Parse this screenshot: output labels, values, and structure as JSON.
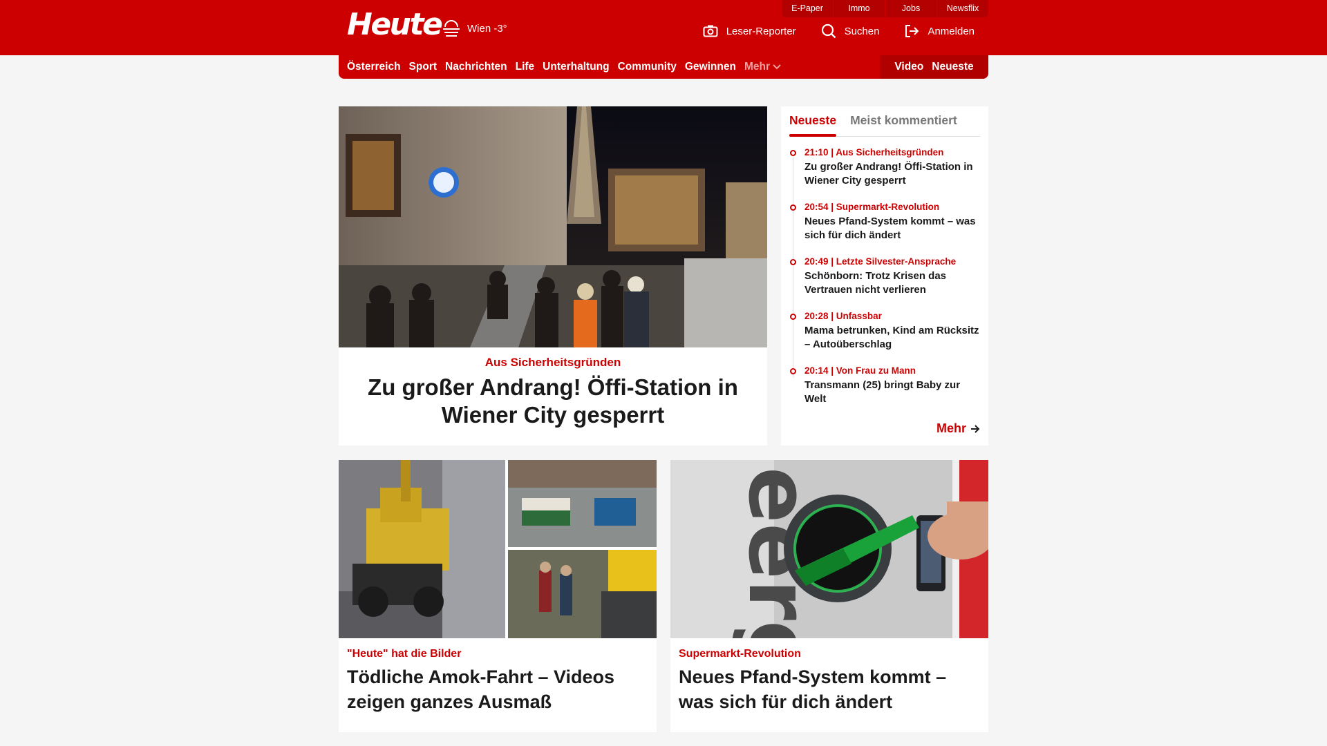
{
  "header": {
    "logo": "Heute",
    "weather": "Wien -3°",
    "service_links": [
      "E-Paper",
      "Immo",
      "Jobs",
      "Newsflix"
    ],
    "actions": {
      "reporter": "Leser-Reporter",
      "search": "Suchen",
      "login": "Anmelden"
    }
  },
  "nav": {
    "items": [
      "Österreich",
      "Sport",
      "Nachrichten",
      "Life",
      "Unterhaltung",
      "Community",
      "Gewinnen"
    ],
    "more": "Mehr",
    "video": "Video",
    "latest": "Neueste"
  },
  "hero": {
    "kicker": "Aus Sicherheitsgründen",
    "headline": "Zu großer Andrang! Öffi-Station in Wiener City gesperrt"
  },
  "sidebar": {
    "tabs": [
      "Neueste",
      "Meist kommentiert"
    ],
    "items": [
      {
        "meta": "21:10 | Aus Sicherheitsgründen",
        "title": "Zu großer Andrang! Öffi-Station in Wiener City gesperrt"
      },
      {
        "meta": "20:54 | Supermarkt-Revolution",
        "title": "Neues Pfand-System kommt – was sich für dich ändert"
      },
      {
        "meta": "20:49 | Letzte Silvester-Ansprache",
        "title": "Schönborn: Trotz Krisen das Vertrauen nicht verlieren"
      },
      {
        "meta": "20:28 | Unfassbar",
        "title": "Mama betrunken, Kind am Rücksitz – Autoüberschlag"
      },
      {
        "meta": "20:14 | Von Frau zu Mann",
        "title": "Transmann (25) bringt Baby zur Welt"
      }
    ],
    "more": "Mehr"
  },
  "cards": [
    {
      "kicker": "\"Heute\" hat die Bilder",
      "headline": "Tödliche Amok-Fahrt – Videos zeigen ganzes Ausmaß"
    },
    {
      "kicker": "Supermarkt-Revolution",
      "headline": "Neues Pfand-System kommt – was sich für dich ändert"
    }
  ],
  "colors": {
    "brand": "#cc0000",
    "background": "#f5f5f5"
  }
}
